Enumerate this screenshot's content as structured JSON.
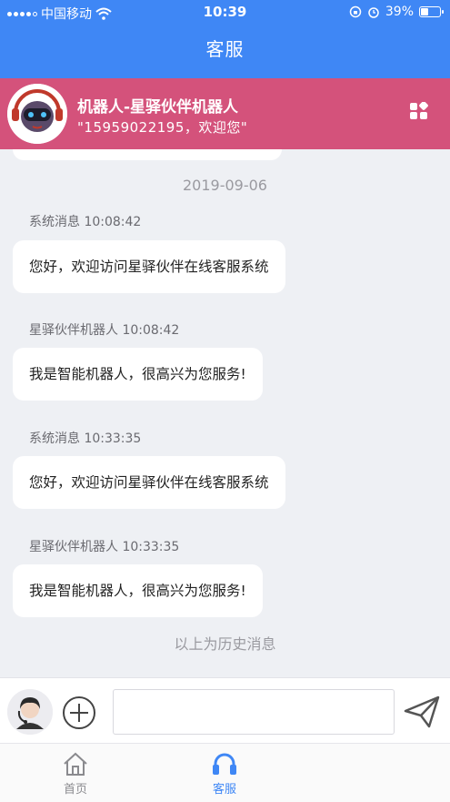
{
  "status_bar": {
    "carrier": "中国移动",
    "time": "10:39",
    "battery": "39%"
  },
  "header": {
    "title": "客服"
  },
  "banner": {
    "name": "机器人-星驿伙伴机器人",
    "subtitle": "\"15959022195，欢迎您\""
  },
  "chat": {
    "date": "2019-09-06",
    "messages": [
      {
        "sender": "系统消息 10:08:42",
        "text": "您好，欢迎访问星驿伙伴在线客服系统"
      },
      {
        "sender": "星驿伙伴机器人 10:08:42",
        "text": "我是智能机器人，很高兴为您服务!"
      },
      {
        "sender": "系统消息 10:33:35",
        "text": "您好，欢迎访问星驿伙伴在线客服系统"
      },
      {
        "sender": "星驿伙伴机器人 10:33:35",
        "text": "我是智能机器人，很高兴为您服务!"
      }
    ],
    "history_note": "以上为历史消息"
  },
  "input": {
    "value": "",
    "placeholder": ""
  },
  "tabs": [
    {
      "label": "首页",
      "icon": "home-icon",
      "active": false
    },
    {
      "label": "客服",
      "icon": "headset-icon",
      "active": true
    }
  ],
  "colors": {
    "header": "#3f87f5",
    "banner": "#d4527b",
    "active_tab": "#3f87f5"
  }
}
